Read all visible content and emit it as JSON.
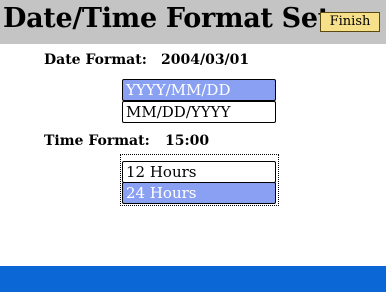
{
  "header": {
    "title": "Date/Time Format Set...",
    "finish_label": "Finish"
  },
  "date_format": {
    "label": "Date Format:",
    "value": "2004/03/01",
    "options": [
      "YYYY/MM/DD",
      "MM/DD/YYYY"
    ],
    "selected": "YYYY/MM/DD"
  },
  "time_format": {
    "label": "Time Format:",
    "value": "15:00",
    "options": [
      "12 Hours",
      "24 Hours"
    ],
    "selected": "24 Hours"
  },
  "colors": {
    "header_bg": "#c4c4c4",
    "selected_option_bg": "#8aa0f2",
    "finish_button_bg": "#f6e08a",
    "bottom_bar": "#0b66d6"
  }
}
